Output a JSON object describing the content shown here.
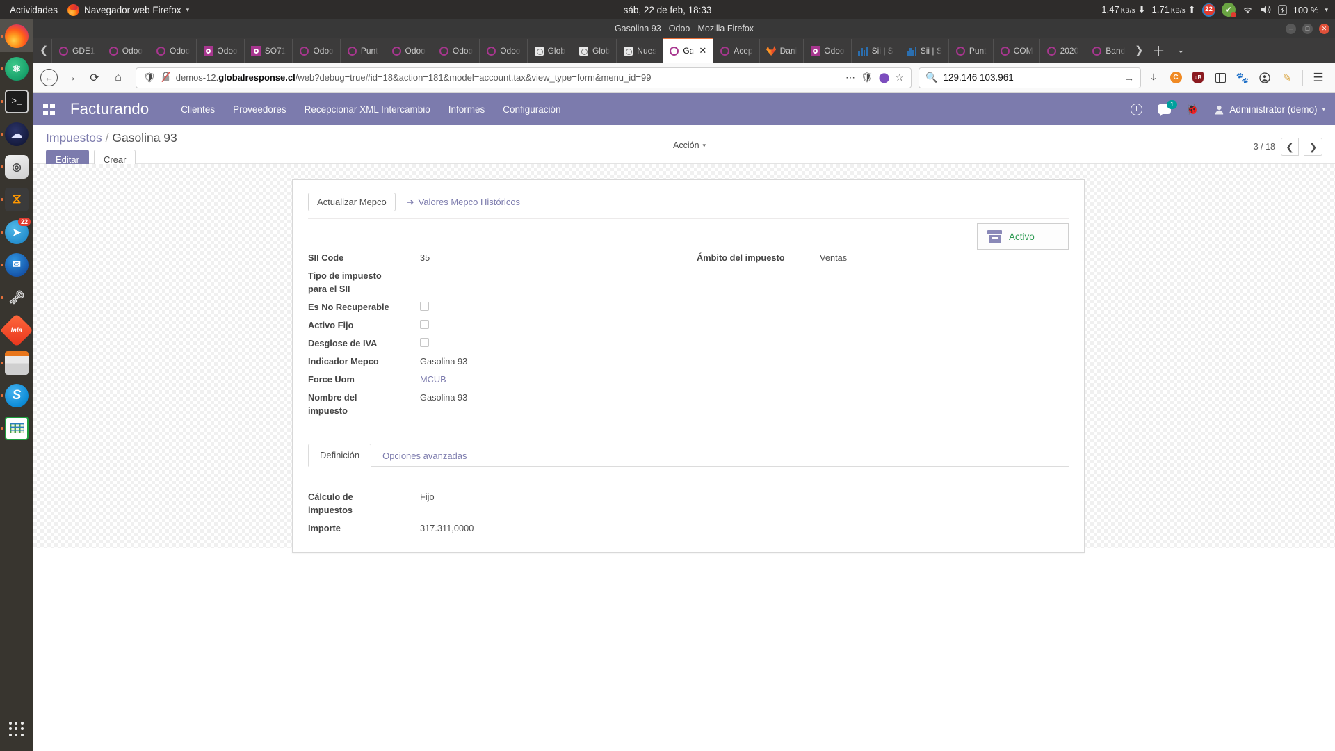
{
  "desktop": {
    "activities": "Actividades",
    "app_menu": "Navegador web Firefox",
    "clock": "sáb, 22 de feb, 18:33",
    "tray": {
      "download_speed": "1.47",
      "download_unit": "KB/s",
      "upload_speed": "1.71",
      "upload_unit": "KB/s",
      "notification_count": "22",
      "battery": "100 %"
    },
    "dock": [
      {
        "name": "firefox",
        "label": "Firefox",
        "running": true,
        "active": true
      },
      {
        "name": "atom",
        "label": "Atom",
        "running": true,
        "active": false
      },
      {
        "name": "terminal",
        "label": "Terminal",
        "running": true,
        "active": false
      },
      {
        "name": "cloud-app",
        "label": "Cloud",
        "running": true,
        "active": false
      },
      {
        "name": "disk-utility",
        "label": "Discos",
        "running": true,
        "active": false
      },
      {
        "name": "sublime-text",
        "label": "Sublime Text",
        "running": true,
        "active": false
      },
      {
        "name": "telegram",
        "label": "Telegram",
        "running": true,
        "active": false,
        "badge": "22"
      },
      {
        "name": "thunderbird",
        "label": "Thunderbird",
        "running": true,
        "active": false
      },
      {
        "name": "keepass",
        "label": "KeePass",
        "running": true,
        "active": false
      },
      {
        "name": "lala-app",
        "label": "Lala",
        "running": true,
        "active": false
      },
      {
        "name": "files",
        "label": "Archivos",
        "running": true,
        "active": false
      },
      {
        "name": "skype",
        "label": "Skype",
        "running": true,
        "active": false
      },
      {
        "name": "calc",
        "label": "LibreOffice Calc",
        "running": true,
        "active": false
      }
    ],
    "show_apps": "Mostrar aplicaciones"
  },
  "browser": {
    "window_title": "Gasolina 93 - Odoo - Mozilla Firefox",
    "tabs": [
      {
        "label": "GDE1",
        "icon": "odoo-icon",
        "active": false
      },
      {
        "label": "Odoo",
        "icon": "odoo-icon",
        "active": false
      },
      {
        "label": "Odoo",
        "icon": "odoo-icon",
        "active": false
      },
      {
        "label": "Odoo",
        "icon": "odoo-icon-inverted",
        "active": false
      },
      {
        "label": "SO71",
        "icon": "odoo-icon-inverted",
        "active": false
      },
      {
        "label": "Odoo",
        "icon": "odoo-icon",
        "active": false
      },
      {
        "label": "Punt",
        "icon": "odoo-icon",
        "active": false
      },
      {
        "label": "Odoo",
        "icon": "odoo-icon",
        "active": false
      },
      {
        "label": "Odoo",
        "icon": "odoo-icon",
        "active": false
      },
      {
        "label": "Odoo",
        "icon": "odoo-icon",
        "active": false
      },
      {
        "label": "Glob",
        "icon": "document-icon",
        "active": false
      },
      {
        "label": "Glob",
        "icon": "document-icon",
        "active": false
      },
      {
        "label": "Nues",
        "icon": "document-icon",
        "active": false
      },
      {
        "label": "Ga",
        "icon": "odoo-icon",
        "active": true,
        "close": "✕"
      },
      {
        "label": "Acep",
        "icon": "odoo-icon",
        "active": false
      },
      {
        "label": "Dani",
        "icon": "gitlab-icon",
        "active": false
      },
      {
        "label": "Odoo",
        "icon": "odoo-icon-inverted",
        "active": false
      },
      {
        "label": "Sii | S",
        "icon": "sii-icon",
        "active": false
      },
      {
        "label": "Sii | S",
        "icon": "sii-icon",
        "active": false
      },
      {
        "label": "Punt",
        "icon": "odoo-icon",
        "active": false
      },
      {
        "label": "COM",
        "icon": "odoo-icon",
        "active": false
      },
      {
        "label": "2020",
        "icon": "odoo-icon",
        "active": false
      },
      {
        "label": "Band",
        "icon": "odoo-icon",
        "active": false
      }
    ],
    "url": {
      "host_prefix": "demos-12.",
      "host_bold": "globalresponse.cl",
      "path": "/web?debug=true#id=18&action=181&model=account.tax&view_type=form&menu_id=99"
    },
    "search_value": "129.146   103.961",
    "toolbar_icons": [
      "download-icon",
      "containers-icon",
      "ublock-icon",
      "sidebar-icon",
      "devtools-icon",
      "account-icon",
      "pencil-icon",
      "hamburger-menu-icon"
    ]
  },
  "odoo": {
    "app_name": "Facturando",
    "menus": [
      "Clientes",
      "Proveedores",
      "Recepcionar XML Intercambio",
      "Informes",
      "Configuración"
    ],
    "messages_count": "1",
    "user": "Administrator (demo)",
    "breadcrumb": {
      "root": "Impuestos",
      "sep": "/",
      "current": "Gasolina 93"
    },
    "buttons": {
      "edit": "Editar",
      "create": "Crear",
      "action": "Acción"
    },
    "pager": {
      "count": "3 / 18",
      "prev": "❮",
      "next": "❯"
    },
    "sheet": {
      "stat_button": "Actualizar Mepco",
      "stat_link": "Valores Mepco Históricos",
      "active_badge": "Activo",
      "left_fields": [
        {
          "label": "SII Code",
          "value": "35",
          "type": "text"
        },
        {
          "label": "Tipo de impuesto para el SII",
          "value": "",
          "type": "text"
        },
        {
          "label": "Es No Recuperable",
          "value": "",
          "type": "checkbox",
          "checked": false
        },
        {
          "label": "Activo Fijo",
          "value": "",
          "type": "checkbox",
          "checked": false
        },
        {
          "label": "Desglose de IVA",
          "value": "",
          "type": "checkbox",
          "checked": false
        },
        {
          "label": "Indicador Mepco",
          "value": "Gasolina 93",
          "type": "text"
        },
        {
          "label": "Force Uom",
          "value": "MCUB",
          "type": "link"
        },
        {
          "label": "Nombre del impuesto",
          "value": "Gasolina 93",
          "type": "text"
        }
      ],
      "right_fields": [
        {
          "label": "Ámbito del impuesto",
          "value": "Ventas",
          "type": "text"
        }
      ],
      "notebook_tabs": [
        {
          "label": "Definición",
          "active": true
        },
        {
          "label": "Opciones avanzadas",
          "active": false
        }
      ],
      "notebook_fields": [
        {
          "label": "Cálculo de impuestos",
          "value": "Fijo",
          "type": "text"
        },
        {
          "label": "Importe",
          "value": "317.311,0000",
          "type": "text"
        }
      ]
    }
  },
  "colors": {
    "odoo_purple": "#7c7bad",
    "active_green": "#2e9b53",
    "firefox_tab_accent": "#e8703a",
    "teal_badge": "#00a09d"
  }
}
